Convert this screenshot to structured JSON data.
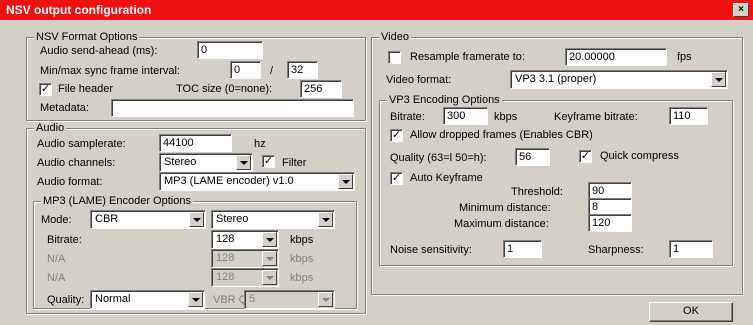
{
  "window": {
    "title": "NSV output configuration",
    "close_glyph": "×"
  },
  "nsv": {
    "legend": "NSV Format Options",
    "send_ahead_label": "Audio send-ahead (ms):",
    "send_ahead_value": "0",
    "sync_label": "Min/max sync frame interval:",
    "sync_min": "0",
    "sync_sep": "/",
    "sync_max": "32",
    "file_header_checked": "✓",
    "file_header_label": "File header",
    "toc_label": "TOC size (0=none):",
    "toc_value": "256",
    "metadata_label": "Metadata:",
    "metadata_value": ""
  },
  "audio": {
    "legend": "Audio",
    "samplerate_label": "Audio samplerate:",
    "samplerate_value": "44100",
    "samplerate_unit": "hz",
    "channels_label": "Audio channels:",
    "channels_value": "Stereo",
    "filter_checked": "✓",
    "filter_label": "Filter",
    "format_label": "Audio format:",
    "format_value": "MP3 (LAME encoder) v1.0"
  },
  "lame": {
    "legend": "MP3 (LAME) Encoder Options",
    "mode_label": "Mode:",
    "mode_value": "CBR",
    "stereo_value": "Stereo",
    "bitrate_label": "Bitrate:",
    "bitrate_value": "128",
    "bitrate_unit": "kbps",
    "na1_label": "N/A",
    "na1_value": "128",
    "na1_unit": "kbps",
    "na2_label": "N/A",
    "na2_value": "128",
    "na2_unit": "kbps",
    "quality_label": "Quality:",
    "quality_value": "Normal",
    "vbrq_label": "VBR Q:",
    "vbrq_value": "5"
  },
  "video": {
    "legend": "Video",
    "resample_label": "Resample framerate to:",
    "resample_value": "20.00000",
    "resample_unit": "fps",
    "format_label": "Video format:",
    "format_value": "VP3 3.1 (proper)"
  },
  "vp3": {
    "legend": "VP3 Encoding Options",
    "bitrate_label": "Bitrate:",
    "bitrate_value": "300",
    "bitrate_unit": "kbps",
    "kf_bitrate_label": "Keyframe bitrate:",
    "kf_bitrate_value": "110",
    "dropped_checked": "✓",
    "dropped_label": "Allow dropped frames (Enables CBR)",
    "quality_label": "Quality (63=l 50=h):",
    "quality_value": "56",
    "quick_checked": "✓",
    "quick_label": "Quick compress",
    "autokf_checked": "✓",
    "autokf_label": "Auto Keyframe",
    "threshold_label": "Threshold:",
    "threshold_value": "90",
    "min_dist_label": "Minimum distance:",
    "min_dist_value": "8",
    "max_dist_label": "Maximum distance:",
    "max_dist_value": "120",
    "noise_label": "Noise sensitivity:",
    "noise_value": "1",
    "sharp_label": "Sharpness:",
    "sharp_value": "1"
  },
  "buttons": {
    "ok": "OK"
  },
  "colors": {
    "titlebar": "#ef1010",
    "face": "#d4d0c8"
  }
}
